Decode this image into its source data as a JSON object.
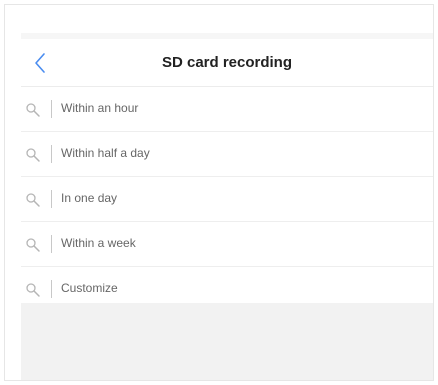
{
  "header": {
    "title": "SD card recording",
    "back_icon": "chevron-left-icon",
    "accent_color": "#4a8cf0"
  },
  "options": [
    {
      "label": "Within an hour",
      "icon": "search-icon"
    },
    {
      "label": "Within half a day",
      "icon": "search-icon"
    },
    {
      "label": "In one day",
      "icon": "search-icon"
    },
    {
      "label": "Within a week",
      "icon": "search-icon"
    },
    {
      "label": "Customize",
      "icon": "search-icon"
    }
  ]
}
